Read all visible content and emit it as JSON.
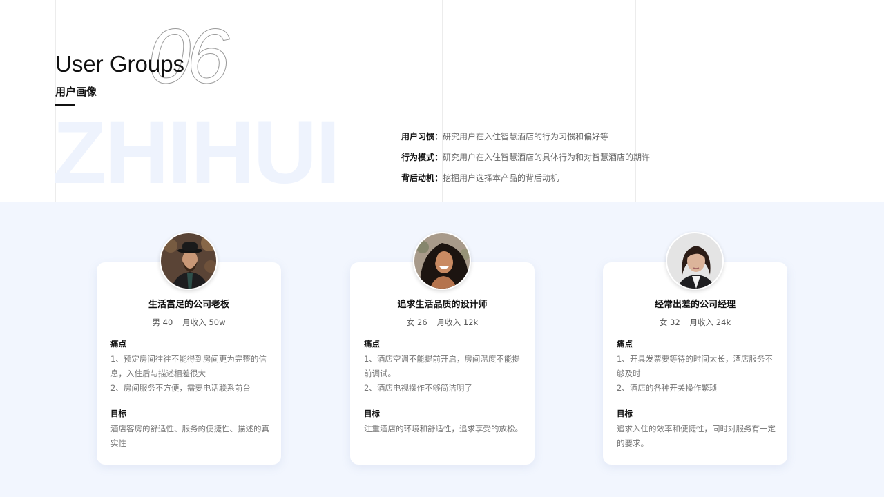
{
  "page": {
    "section_number": "06",
    "title": "User Groups",
    "subtitle": "用户画像",
    "watermark": "ZHIHUI"
  },
  "research": [
    {
      "label": "用户习惯：",
      "text": "研究用户在入住智慧酒店的行为习惯和偏好等"
    },
    {
      "label": "行为模式：",
      "text": "研究用户在入住智慧酒店的具体行为和对智慧酒店的期许"
    },
    {
      "label": "背后动机：",
      "text": "挖掘用户选择本产品的背后动机"
    }
  ],
  "personas": [
    {
      "name": "生活富足的公司老板",
      "gender_age": "男 40",
      "income": "月收入 50w",
      "pains_label": "痛点",
      "pains": [
        "1、预定房间往往不能得到房间更为完整的信息，入住后与描述相差很大",
        "2、房间服务不方便，需要电话联系前台"
      ],
      "goals_label": "目标",
      "goals": "酒店客房的舒适性、服务的便捷性、描述的真实性",
      "avatar": "man-in-hat-photo"
    },
    {
      "name": "追求生活品质的设计师",
      "gender_age": "女 26",
      "income": "月收入 12k",
      "pains_label": "痛点",
      "pains": [
        "1、酒店空调不能提前开启，房间温度不能提前调试。",
        "2、酒店电视操作不够简洁明了"
      ],
      "goals_label": "目标",
      "goals": "注重酒店的环境和舒适性，追求享受的放松。",
      "avatar": "smiling-woman-photo"
    },
    {
      "name": "经常出差的公司经理",
      "gender_age": "女 32",
      "income": "月收入 24k",
      "pains_label": "痛点",
      "pains": [
        "1、开具发票要等待的时间太长，酒店服务不够及时",
        "2、酒店的各种开关操作繁琐"
      ],
      "goals_label": "目标",
      "goals": "追求入住的效率和便捷性，同时对服务有一定的要求。",
      "avatar": "businesswoman-photo"
    }
  ],
  "colors": {
    "bottom_background": "#f2f6fe",
    "watermark": "#eef3fd",
    "accent_text": "#111111"
  }
}
